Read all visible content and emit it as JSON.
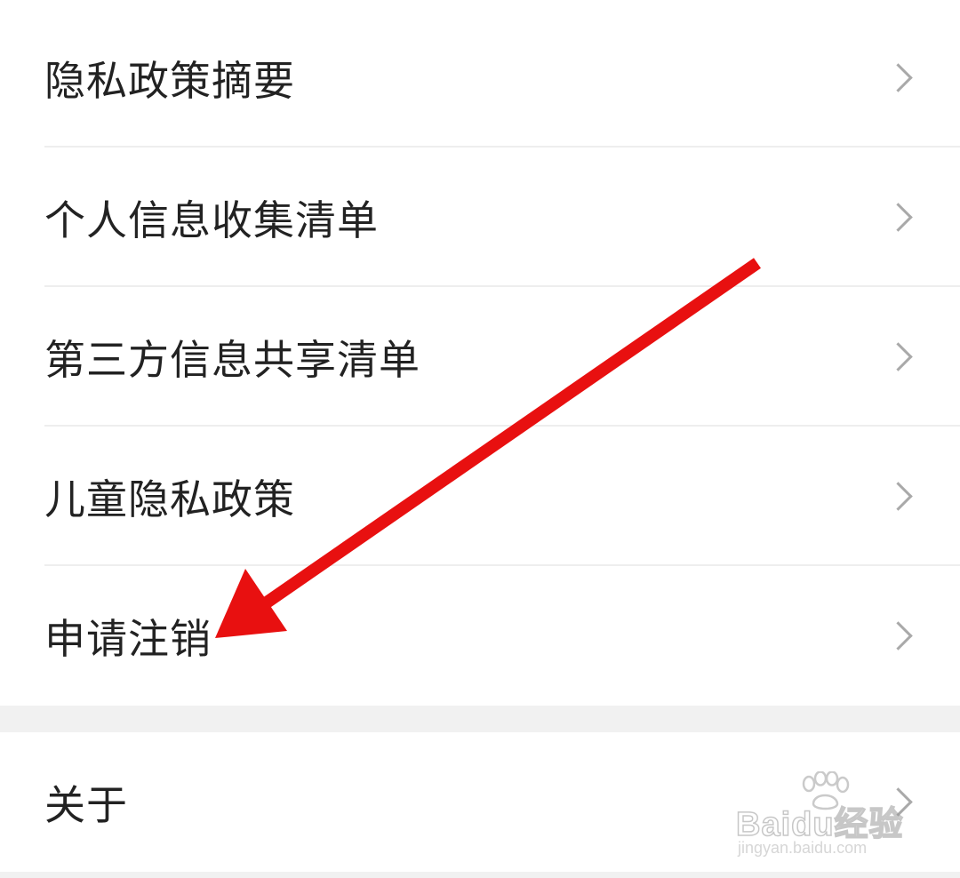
{
  "settings_list": {
    "items": [
      {
        "label": "隐私政策摘要",
        "icon": "chevron-right-icon"
      },
      {
        "label": "个人信息收集清单",
        "icon": "chevron-right-icon"
      },
      {
        "label": "第三方信息共享清单",
        "icon": "chevron-right-icon"
      },
      {
        "label": "儿童隐私政策",
        "icon": "chevron-right-icon"
      },
      {
        "label": "申请注销",
        "icon": "chevron-right-icon"
      }
    ]
  },
  "about_group": {
    "label": "关于",
    "icon": "chevron-right-icon"
  },
  "watermark": {
    "logo_text": "Baidu经验",
    "url": "jingyan.baidu.com"
  },
  "annotation": {
    "type": "red-arrow",
    "color": "#e81010",
    "points_to": "申请注销"
  },
  "colors": {
    "background": "#f1f1f1",
    "row": "#ffffff",
    "text": "#222222",
    "chevron": "#a9a9a9",
    "divider": "#eeeeee"
  }
}
